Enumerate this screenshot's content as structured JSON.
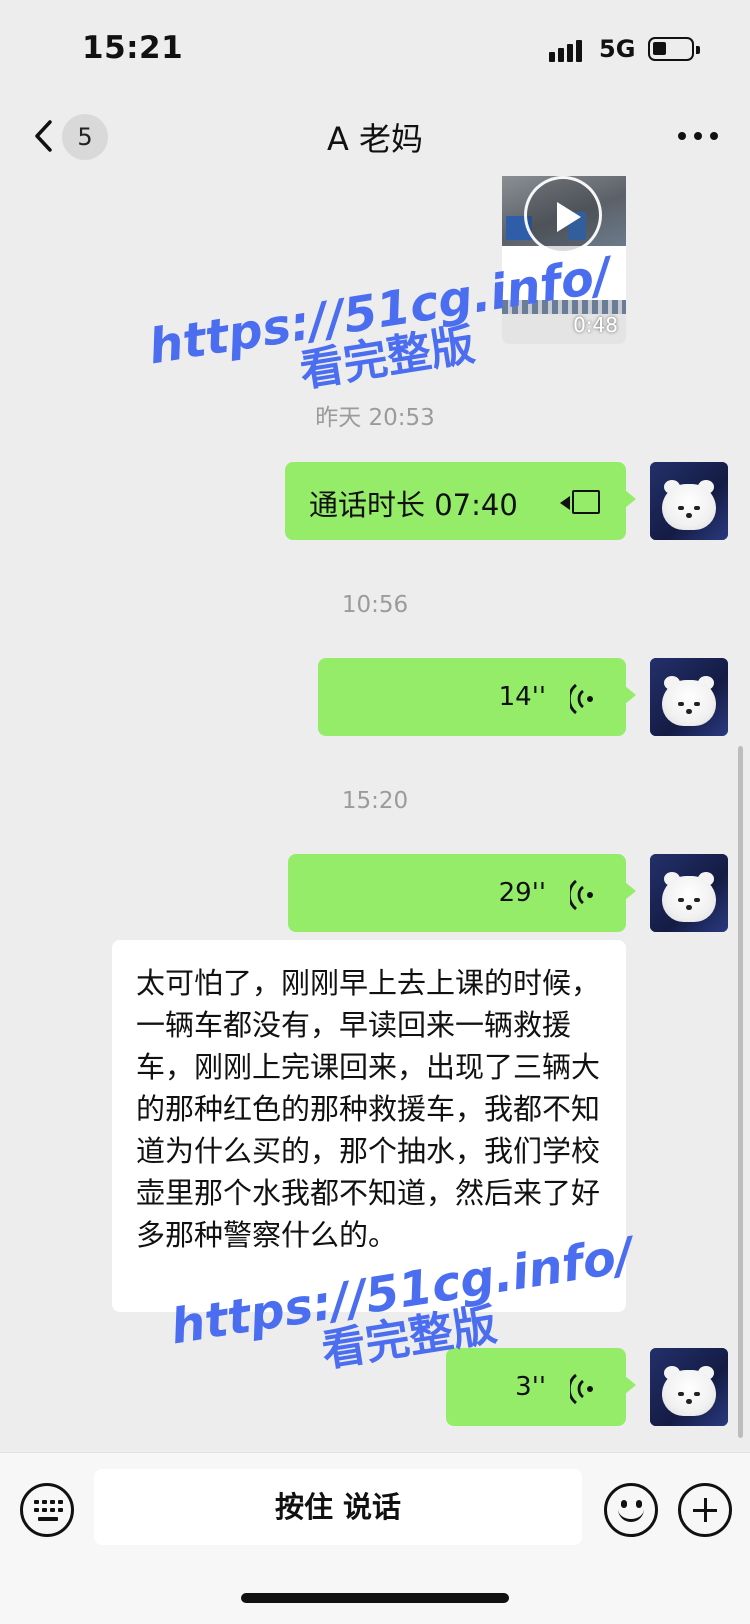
{
  "status_bar": {
    "time": "15:21",
    "network": "5G",
    "battery_level": 0.35
  },
  "header": {
    "back_count": "5",
    "title": "A 老妈"
  },
  "messages": {
    "video": {
      "duration": "0:48"
    },
    "timestamp_1": "昨天 20:53",
    "call": {
      "text": "通话时长 07:40"
    },
    "timestamp_2": "10:56",
    "voice_1": {
      "duration": "14''"
    },
    "timestamp_3": "15:20",
    "voice_2": {
      "duration": "29''"
    },
    "incoming_text": "太可怕了，刚刚早上去上课的时候，一辆车都没有，早读回来一辆救援车，刚刚上完课回来，出现了三辆大的那种红色的那种救援车，我都不知道为什么买的，那个抽水，我们学校壶里那个水我都不知道，然后来了好多那种警察什么的。",
    "voice_3": {
      "duration": "3''"
    }
  },
  "watermark": {
    "url": "https://51cg.info/",
    "subtitle": "看完整版"
  },
  "input_bar": {
    "hold_to_talk": "按住 说话"
  },
  "colors": {
    "outgoing_bubble": "#95ec69",
    "background": "#ededed",
    "watermark": "#4b6df0"
  }
}
